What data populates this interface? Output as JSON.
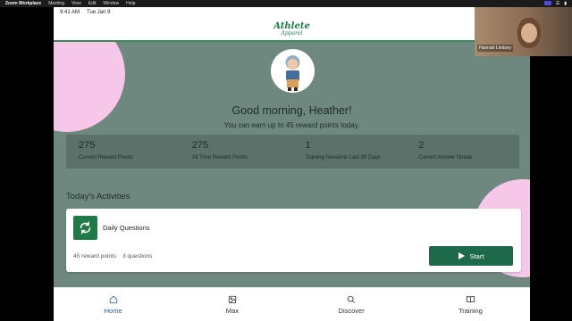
{
  "menubar": {
    "app": "Zoom Workplace",
    "items": [
      "Meeting",
      "View",
      "Edit",
      "Window",
      "Help"
    ]
  },
  "statusbar": {
    "time": "9:41 AM",
    "date": "Tue Jan 9"
  },
  "logo": {
    "line1": "Athlete",
    "line2": "Apparel"
  },
  "greeting": "Good morning, Heather!",
  "subgreeting": "You can earn up to 45 reward points today.",
  "stats": [
    {
      "value": "275",
      "label": "Current Reward Points"
    },
    {
      "value": "275",
      "label": "All Time Reward Points"
    },
    {
      "value": "1",
      "label": "Training Sessions Last 30 Days"
    },
    {
      "value": "2",
      "label": "Correct Answer Streak"
    }
  ],
  "section_title": "Today's Activities",
  "activity": {
    "title": "Daily Questions",
    "points": "45 reward points",
    "questions": "3 questions",
    "start_label": "Start"
  },
  "tabs": [
    {
      "label": "Home",
      "icon": "home-icon",
      "active": true
    },
    {
      "label": "Max",
      "icon": "image-icon",
      "active": false
    },
    {
      "label": "Discover",
      "icon": "search-icon",
      "active": false
    },
    {
      "label": "Training",
      "icon": "book-icon",
      "active": false
    }
  ],
  "video": {
    "participant": "Hannah Lindsey"
  },
  "colors": {
    "brand_green": "#1f7a47",
    "start_button": "#1e6a4a",
    "app_bg": "#6e8880",
    "accent_pink": "#f6c7e9",
    "active_tab": "#2d5d8f"
  }
}
